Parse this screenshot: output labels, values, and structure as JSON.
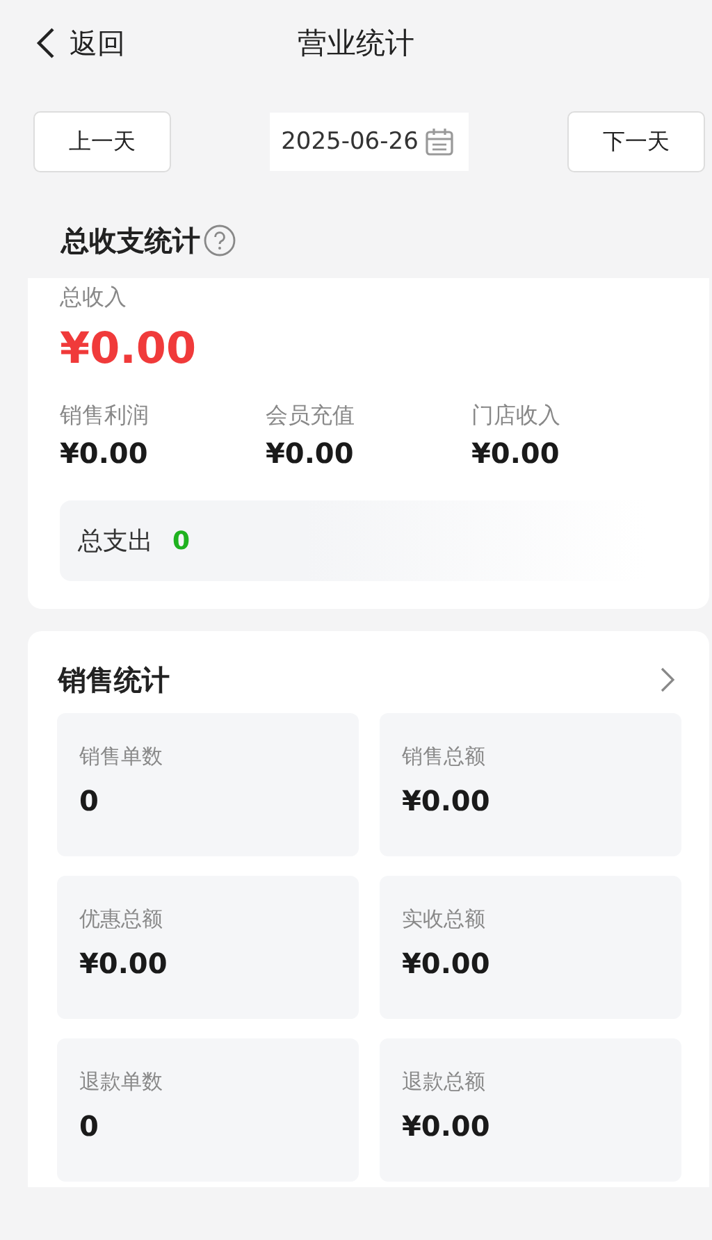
{
  "header": {
    "back": "返回",
    "title": "营业统计"
  },
  "date_bar": {
    "prev": "上一天",
    "date": "2025-06-26",
    "next": "下一天"
  },
  "summary": {
    "title": "总收支统计",
    "income_label": "总收入",
    "income_value": "¥0.00",
    "items": [
      {
        "label": "销售利润",
        "value": "¥0.00"
      },
      {
        "label": "会员充值",
        "value": "¥0.00"
      },
      {
        "label": "门店收入",
        "value": "¥0.00"
      }
    ],
    "expense_label": "总支出",
    "expense_value": "0"
  },
  "sales": {
    "title": "销售统计",
    "tiles": [
      {
        "label": "销售单数",
        "value": "0"
      },
      {
        "label": "销售总额",
        "value": "¥0.00"
      },
      {
        "label": "优惠总额",
        "value": "¥0.00"
      },
      {
        "label": "实收总额",
        "value": "¥0.00"
      },
      {
        "label": "退款单数",
        "value": "0"
      },
      {
        "label": "退款总额",
        "value": "¥0.00"
      }
    ]
  }
}
